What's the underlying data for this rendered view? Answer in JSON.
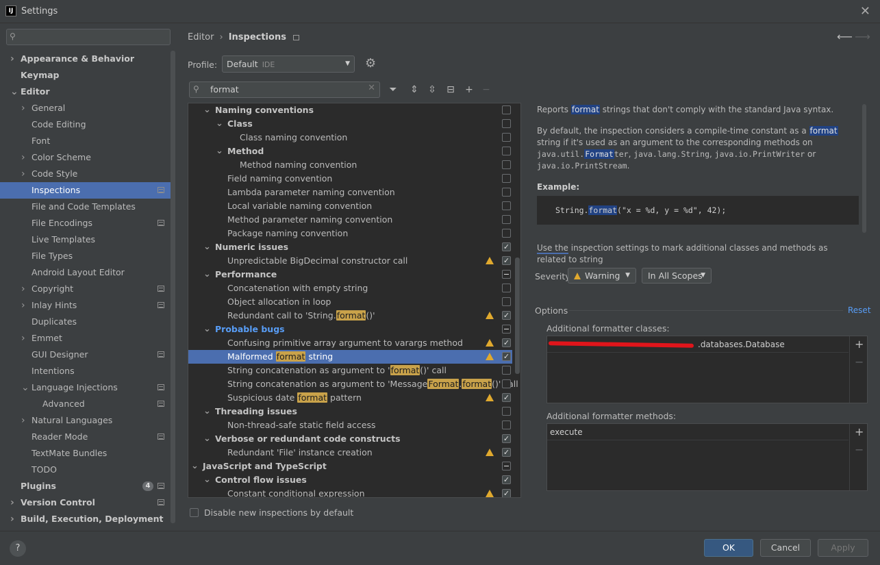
{
  "window": {
    "title": "Settings",
    "app_icon": "IJ"
  },
  "sidebar": {
    "items": [
      {
        "label": "Appearance & Behavior",
        "bold": true,
        "arrow": "right",
        "indent": 0
      },
      {
        "label": "Keymap",
        "bold": true,
        "arrow": "",
        "indent": 0
      },
      {
        "label": "Editor",
        "bold": true,
        "arrow": "down",
        "indent": 0
      },
      {
        "label": "General",
        "arrow": "right",
        "indent": 1
      },
      {
        "label": "Code Editing",
        "arrow": "",
        "indent": 1
      },
      {
        "label": "Font",
        "arrow": "",
        "indent": 1
      },
      {
        "label": "Color Scheme",
        "arrow": "right",
        "indent": 1
      },
      {
        "label": "Code Style",
        "arrow": "right",
        "indent": 1
      },
      {
        "label": "Inspections",
        "arrow": "",
        "indent": 1,
        "selected": true,
        "icon": true
      },
      {
        "label": "File and Code Templates",
        "arrow": "",
        "indent": 1
      },
      {
        "label": "File Encodings",
        "arrow": "",
        "indent": 1,
        "icon": true
      },
      {
        "label": "Live Templates",
        "arrow": "",
        "indent": 1
      },
      {
        "label": "File Types",
        "arrow": "",
        "indent": 1
      },
      {
        "label": "Android Layout Editor",
        "arrow": "",
        "indent": 1
      },
      {
        "label": "Copyright",
        "arrow": "right",
        "indent": 1,
        "icon": true
      },
      {
        "label": "Inlay Hints",
        "arrow": "right",
        "indent": 1,
        "icon": true
      },
      {
        "label": "Duplicates",
        "arrow": "",
        "indent": 1
      },
      {
        "label": "Emmet",
        "arrow": "right",
        "indent": 1
      },
      {
        "label": "GUI Designer",
        "arrow": "",
        "indent": 1,
        "icon": true
      },
      {
        "label": "Intentions",
        "arrow": "",
        "indent": 1
      },
      {
        "label": "Language Injections",
        "arrow": "down",
        "indent": 1,
        "icon": true
      },
      {
        "label": "Advanced",
        "arrow": "",
        "indent": 2,
        "icon": true
      },
      {
        "label": "Natural Languages",
        "arrow": "right",
        "indent": 1
      },
      {
        "label": "Reader Mode",
        "arrow": "",
        "indent": 1,
        "icon": true
      },
      {
        "label": "TextMate Bundles",
        "arrow": "",
        "indent": 1
      },
      {
        "label": "TODO",
        "arrow": "",
        "indent": 1
      },
      {
        "label": "Plugins",
        "bold": true,
        "arrow": "",
        "indent": 0,
        "badge": "4",
        "icon": true
      },
      {
        "label": "Version Control",
        "bold": true,
        "arrow": "right",
        "indent": 0,
        "icon": true
      },
      {
        "label": "Build, Execution, Deployment",
        "bold": true,
        "arrow": "right",
        "indent": 0
      }
    ]
  },
  "breadcrumb": {
    "parent": "Editor",
    "separator": "›",
    "current": "Inspections"
  },
  "profile": {
    "label": "Profile:",
    "value": "Default",
    "scope_tag": "IDE"
  },
  "filter": {
    "value": "format"
  },
  "inspections": [
    {
      "label": "Naming conventions",
      "type": "group",
      "arrow": "down",
      "level": 1,
      "check": "off"
    },
    {
      "label": "Class",
      "type": "group",
      "arrow": "down",
      "level": 2,
      "check": "off"
    },
    {
      "label": "Class naming convention",
      "level": 3,
      "check": "off"
    },
    {
      "label": "Method",
      "type": "group",
      "arrow": "down",
      "level": 2,
      "check": "off"
    },
    {
      "label": "Method naming convention",
      "level": 3,
      "check": "off"
    },
    {
      "label": "Field naming convention",
      "level": 2,
      "check": "off"
    },
    {
      "label": "Lambda parameter naming convention",
      "level": 2,
      "check": "off"
    },
    {
      "label": "Local variable naming convention",
      "level": 2,
      "check": "off"
    },
    {
      "label": "Method parameter naming convention",
      "level": 2,
      "check": "off"
    },
    {
      "label": "Package naming convention",
      "level": 2,
      "check": "off"
    },
    {
      "label": "Numeric issues",
      "type": "group",
      "arrow": "down",
      "level": 1,
      "check": "on"
    },
    {
      "label": "Unpredictable BigDecimal constructor call",
      "level": 2,
      "check": "on",
      "warn": true
    },
    {
      "label": "Performance",
      "type": "group",
      "arrow": "down",
      "level": 1,
      "check": "partial"
    },
    {
      "label": "Concatenation with empty string",
      "level": 2,
      "check": "off"
    },
    {
      "label": "Object allocation in loop",
      "level": 2,
      "check": "off"
    },
    {
      "parts": [
        "Redundant call to 'String.",
        "format",
        "()'"
      ],
      "level": 2,
      "check": "on",
      "warn": true
    },
    {
      "label": "Probable bugs",
      "type": "group",
      "arrow": "down",
      "level": 1,
      "check": "partial",
      "blue": true
    },
    {
      "label": "Confusing primitive array argument to varargs method",
      "level": 2,
      "check": "on",
      "warn": true
    },
    {
      "parts": [
        "Malformed ",
        "format",
        " string"
      ],
      "level": 2,
      "check": "on",
      "warn": true,
      "selected": true
    },
    {
      "parts": [
        "String concatenation as argument to '",
        "format",
        "()' call"
      ],
      "level": 2,
      "check": "off"
    },
    {
      "parts": [
        "String concatenation as argument to 'Message",
        "Format",
        ".",
        "format",
        "()' call"
      ],
      "level": 2,
      "check": "off"
    },
    {
      "parts": [
        "Suspicious date ",
        "format",
        " pattern"
      ],
      "level": 2,
      "check": "on",
      "warn": true
    },
    {
      "label": "Threading issues",
      "type": "group",
      "arrow": "down",
      "level": 1,
      "check": "off"
    },
    {
      "label": "Non-thread-safe static field access",
      "level": 2,
      "check": "off"
    },
    {
      "label": "Verbose or redundant code constructs",
      "type": "group",
      "arrow": "down",
      "level": 1,
      "check": "on"
    },
    {
      "label": "Redundant 'File' instance creation",
      "level": 2,
      "check": "on",
      "warn": true
    },
    {
      "label": "JavaScript and TypeScript",
      "type": "group",
      "arrow": "down",
      "level": 0,
      "check": "partial"
    },
    {
      "label": "Control flow issues",
      "type": "group",
      "arrow": "down",
      "level": 1,
      "check": "on"
    },
    {
      "label": "Constant conditional expression",
      "level": 2,
      "check": "on",
      "warn": true
    }
  ],
  "disable_new": {
    "label": "Disable new inspections by default"
  },
  "description": {
    "p1_a": "Reports ",
    "p1_kw": "format",
    "p1_b": " strings that don't comply with the standard Java syntax.",
    "p2_a": "By default, the inspection considers a compile-time constant as a ",
    "p2_kw": "format",
    "p2_b": " string if it's used as an argument to the corresponding methods on ",
    "p2_c1_a": "java.util.",
    "p2_c1_kw": "Format",
    "p2_c1_b": "ter",
    "p2_c2": "java.lang.String",
    "p2_c3": "java.io.PrintWriter",
    "p2_or": " or ",
    "p2_c4": "java.io.PrintStream",
    "example_title": "Example:",
    "code_a": "String.",
    "code_kw": "format",
    "code_b": "(\"x = %d, y = %d\", 42);",
    "p3_a": "Use the",
    "p3_b": " inspection settings to mark additional classes and methods as related to string"
  },
  "severity": {
    "label": "Severity:",
    "value": "Warning",
    "scope": "In All Scopes"
  },
  "options": {
    "label": "Options",
    "reset": "Reset",
    "classes_label": "Additional formatter classes:",
    "classes_value": ".databases.Database",
    "methods_label": "Additional formatter methods:",
    "methods_value": "execute"
  },
  "footer": {
    "help": "?",
    "ok": "OK",
    "cancel": "Cancel",
    "apply": "Apply"
  }
}
